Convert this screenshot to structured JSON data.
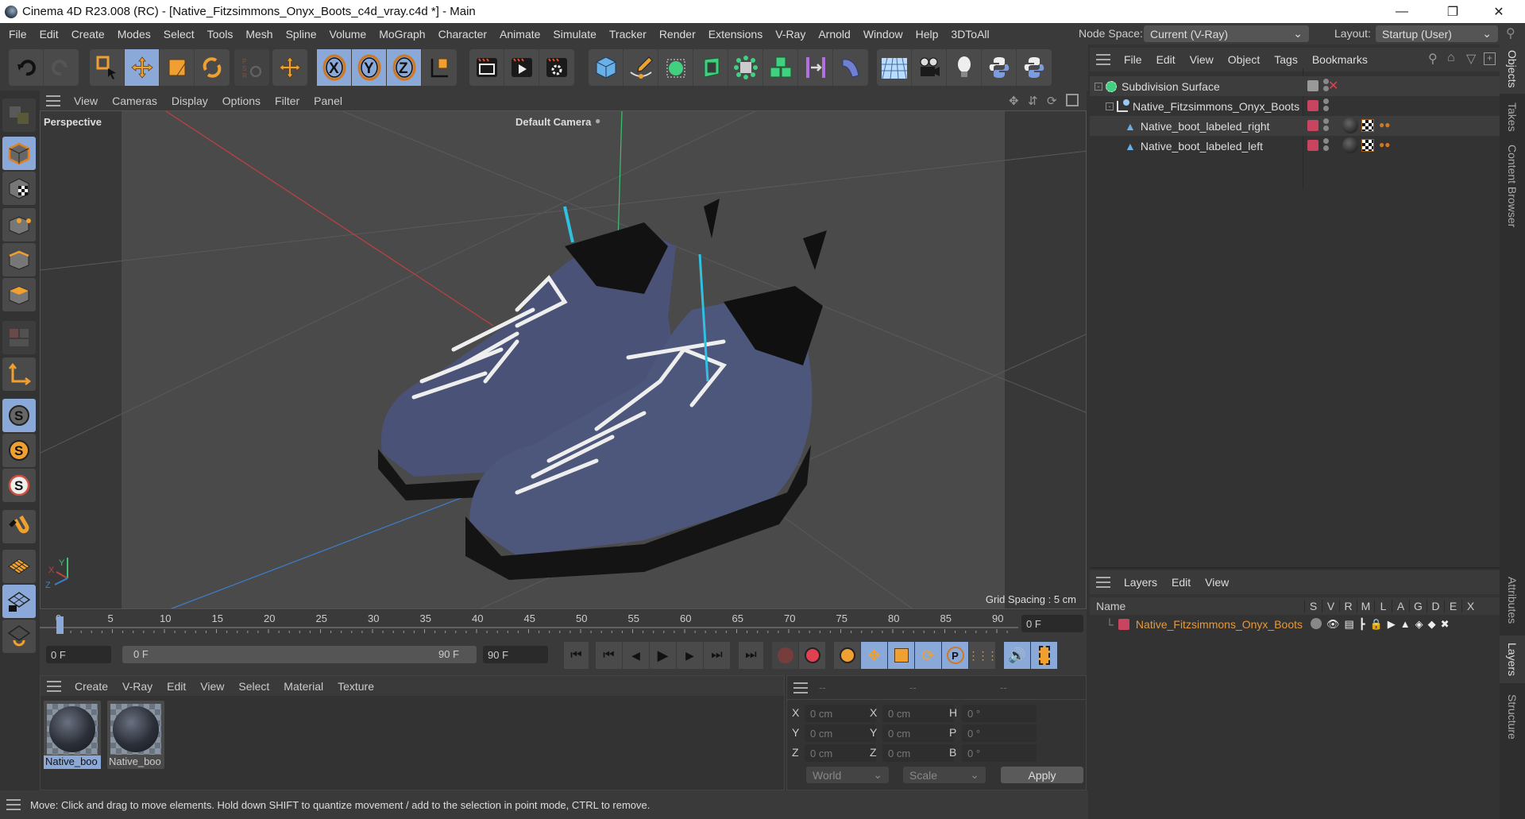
{
  "window": {
    "title": "Cinema 4D R23.008 (RC) - [Native_Fitzsimmons_Onyx_Boots_c4d_vray.c4d *] - Main",
    "controls": [
      "minimize",
      "restore",
      "close"
    ]
  },
  "menubar": {
    "items": [
      "File",
      "Edit",
      "Create",
      "Modes",
      "Select",
      "Tools",
      "Mesh",
      "Spline",
      "Volume",
      "MoGraph",
      "Character",
      "Animate",
      "Simulate",
      "Tracker",
      "Render",
      "Extensions",
      "V-Ray",
      "Arnold",
      "Window",
      "Help",
      "3DToAll"
    ],
    "node_space_label": "Node Space:",
    "node_space_value": "Current (V-Ray)",
    "layout_label": "Layout:",
    "layout_value": "Startup (User)"
  },
  "toolbar": {
    "groups": [
      [
        "undo-icon",
        "redo-icon"
      ],
      [
        "live-selection-icon",
        "move-icon",
        "scale-icon",
        "rotate-icon"
      ],
      [
        "psr-icon"
      ],
      [
        "add-axis-icon"
      ],
      [
        "x-axis-lock-icon",
        "y-axis-lock-icon",
        "z-axis-lock-icon",
        "coordinate-system-icon"
      ],
      [
        "render-view-icon",
        "render-picture-viewer-icon",
        "render-settings-icon"
      ],
      [
        "cube-icon",
        "pen-icon",
        "subdivision-icon",
        "extrude-icon",
        "array-icon",
        "cloner-icon",
        "bend-icon",
        "deformer-icon"
      ],
      [
        "floor-icon",
        "camera-icon",
        "light-icon",
        "python-icon",
        "python-icon-2"
      ]
    ],
    "selected": [
      "move-icon",
      "x-axis-lock-icon",
      "y-axis-lock-icon",
      "z-axis-lock-icon"
    ]
  },
  "left_toolbar": {
    "items": [
      "make-editable-icon",
      "model-mode-icon",
      "texture-mode-icon",
      "points-mode-icon",
      "edges-mode-icon",
      "polygons-mode-icon",
      "uv-mode-icon",
      "axis-mode-icon",
      "snap-icon",
      "snap-settings-icon",
      "snap-workplane-icon",
      "magnet-icon",
      "workplane-icon",
      "locked-workplane-icon",
      "workplane-rotate-icon"
    ],
    "selected": [
      "model-mode-icon",
      "snap-icon",
      "locked-workplane-icon"
    ]
  },
  "viewport": {
    "menu": [
      "View",
      "Cameras",
      "Display",
      "Options",
      "Filter",
      "Panel"
    ],
    "projection": "Perspective",
    "camera": "Default Camera",
    "grid_spacing": "Grid Spacing : 5 cm",
    "axis_labels": {
      "x": "X",
      "y": "Y",
      "z": "Z"
    }
  },
  "timeline": {
    "ticks": [
      "0",
      "5",
      "10",
      "15",
      "20",
      "25",
      "30",
      "35",
      "40",
      "45",
      "50",
      "55",
      "60",
      "65",
      "70",
      "75",
      "80",
      "85",
      "90"
    ],
    "current_frame": "0 F",
    "start_field": "0 F",
    "range_start": "0 F",
    "range_end": "90 F",
    "end_field": "90 F",
    "current_frame_progress": 0
  },
  "material_manager": {
    "menu": [
      "Create",
      "V-Ray",
      "Edit",
      "View",
      "Select",
      "Material",
      "Texture"
    ],
    "materials": [
      {
        "name": "Native_boo",
        "selected": true
      },
      {
        "name": "Native_boo",
        "selected": false
      }
    ]
  },
  "coordinates": {
    "headers": [
      "--",
      "--",
      "--"
    ],
    "rows": [
      {
        "l1": "X",
        "v1": "0 cm",
        "l2": "X",
        "v2": "0 cm",
        "l3": "H",
        "v3": "0 °"
      },
      {
        "l1": "Y",
        "v1": "0 cm",
        "l2": "Y",
        "v2": "0 cm",
        "l3": "P",
        "v3": "0 °"
      },
      {
        "l1": "Z",
        "v1": "0 cm",
        "l2": "Z",
        "v2": "0 cm",
        "l3": "B",
        "v3": "0 °"
      }
    ],
    "space": "World",
    "mode": "Scale",
    "apply": "Apply"
  },
  "status": "Move: Click and drag to move elements. Hold down SHIFT to quantize movement / add to the selection in point mode, CTRL to remove.",
  "objects": {
    "menu": [
      "File",
      "Edit",
      "View",
      "Object",
      "Tags",
      "Bookmarks"
    ],
    "tree": [
      {
        "name": "Subdivision Surface",
        "depth": 0,
        "type": "subdivision"
      },
      {
        "name": "Native_Fitzsimmons_Onyx_Boots",
        "depth": 1,
        "type": "null"
      },
      {
        "name": "Native_boot_labeled_right",
        "depth": 2,
        "type": "polygon"
      },
      {
        "name": "Native_boot_labeled_left",
        "depth": 2,
        "type": "polygon"
      }
    ]
  },
  "layers": {
    "menu": [
      "Layers",
      "Edit",
      "View"
    ],
    "columns": [
      "Name",
      "S",
      "V",
      "R",
      "M",
      "L",
      "A",
      "G",
      "D",
      "E",
      "X"
    ],
    "rows": [
      {
        "name": "Native_Fitzsimmons_Onyx_Boots",
        "color": "#c8445f"
      }
    ]
  },
  "side_tabs": {
    "top": [
      "Objects",
      "Takes",
      "Content Browser"
    ],
    "bottom": [
      "Attributes",
      "Layers",
      "Structure"
    ]
  },
  "colors": {
    "accent_selected": "#8aa9d8",
    "orange": "#f0a030",
    "layer_red": "#c8445f",
    "boot_upper": "#4a5377",
    "lace": "#eeeeee"
  }
}
